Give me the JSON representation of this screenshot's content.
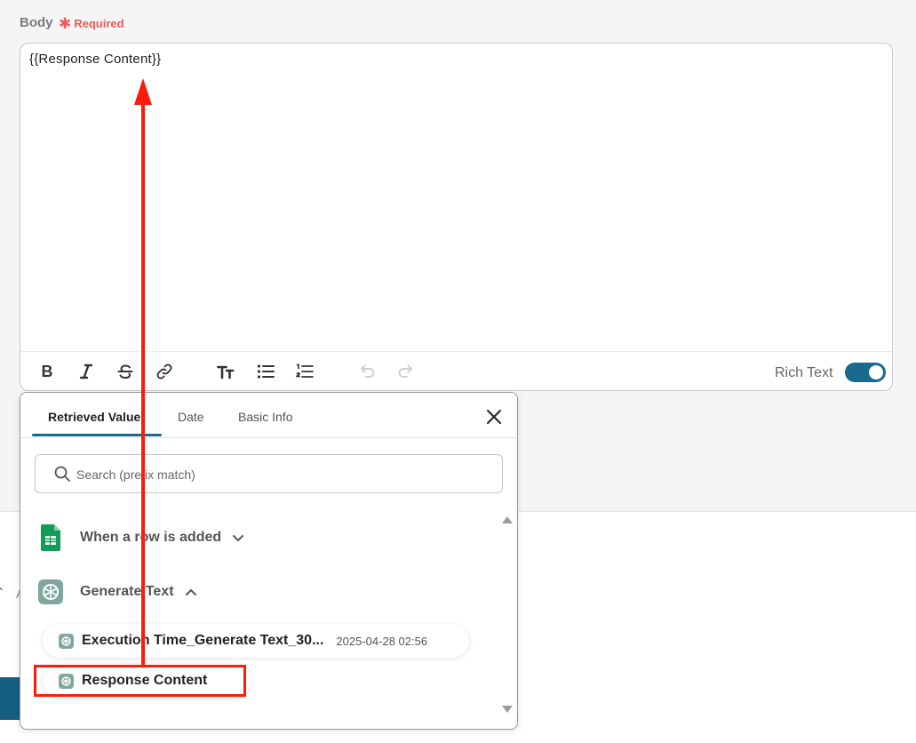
{
  "field": {
    "label": "Body",
    "required_mark": "✱",
    "required_text": "Required"
  },
  "editor": {
    "content": "{{Response Content}}",
    "toolbar": {
      "bold": "B",
      "rich_text_label": "Rich Text",
      "rich_text_on": true
    }
  },
  "popup": {
    "tabs": [
      {
        "label": "Retrieved Value",
        "active": true
      },
      {
        "label": "Date",
        "active": false
      },
      {
        "label": "Basic Info",
        "active": false
      }
    ],
    "search": {
      "placeholder": "Search (prefix match)",
      "value": ""
    },
    "groups": [
      {
        "label": "When a row is added",
        "icon": "google-sheets-icon",
        "expanded": false
      },
      {
        "label": "Generate Text",
        "icon": "openai-icon",
        "expanded": true
      }
    ],
    "items": [
      {
        "label": "Execution Time_Generate Text_30...",
        "meta": "2025-04-28 02:56"
      },
      {
        "label": "Response Content",
        "meta": ""
      }
    ]
  },
  "colors": {
    "accent": "#176a8e",
    "required": "#ef5b5b",
    "annotation": "#ff1a0a",
    "sheets_green": "#0f9d58",
    "openai_gray": "#7fa79f"
  }
}
